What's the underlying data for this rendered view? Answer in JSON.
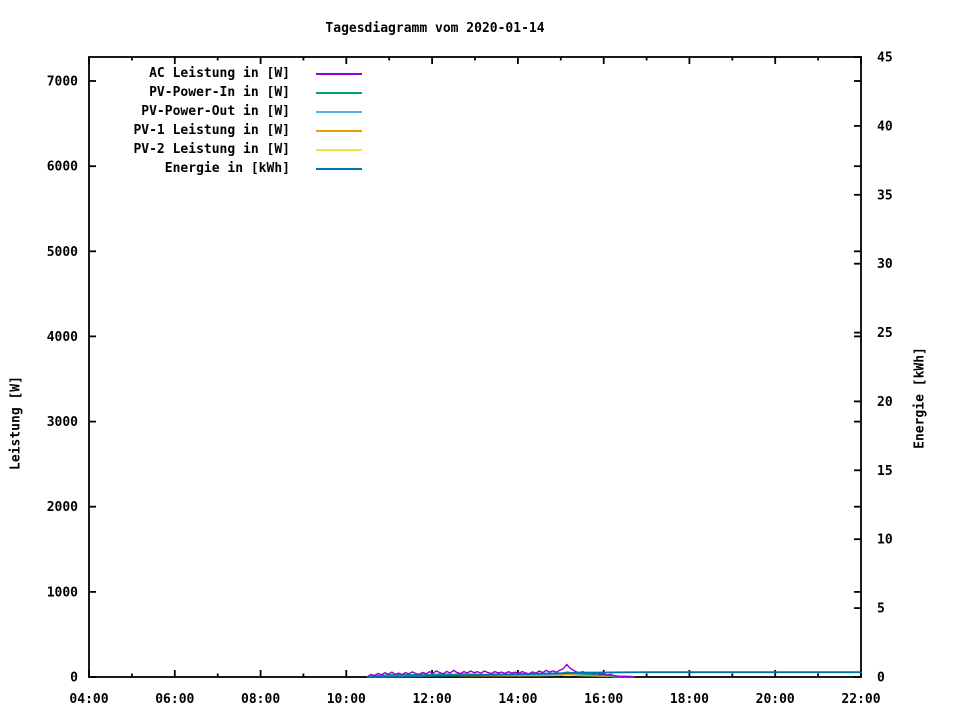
{
  "title": "Tagesdiagramm vom 2020-01-14",
  "chart_data": {
    "type": "line",
    "title": "Tagesdiagramm vom 2020-01-14",
    "grid": false,
    "legend_position": "top-left-inside",
    "background_color": "#ffffff",
    "border_color": "#000000",
    "x_axis": {
      "unit": "time",
      "range_hours": [
        4,
        22
      ],
      "major_tick_hours": [
        4,
        6,
        8,
        10,
        12,
        14,
        16,
        18,
        20,
        22
      ],
      "major_tick_labels": [
        "04:00",
        "06:00",
        "08:00",
        "10:00",
        "12:00",
        "14:00",
        "16:00",
        "18:00",
        "20:00",
        "22:00"
      ],
      "minor_tick_every_hours": 1
    },
    "y1_axis": {
      "label": "Leistung [W]",
      "range": [
        0,
        7282
      ],
      "ticks": [
        0,
        1000,
        2000,
        3000,
        4000,
        5000,
        6000,
        7000
      ],
      "tick_labels": [
        "0",
        "1000",
        "2000",
        "3000",
        "4000",
        "5000",
        "6000",
        "7000"
      ]
    },
    "y2_axis": {
      "label": "Energie [kWh]",
      "range": [
        0,
        45
      ],
      "ticks": [
        0,
        5,
        10,
        15,
        20,
        25,
        30,
        35,
        40,
        45
      ],
      "tick_labels": [
        "0",
        "5",
        "10",
        "15",
        "20",
        "25",
        "30",
        "35",
        "40",
        "45"
      ]
    },
    "series": [
      {
        "name": "AC Leistung in [W]",
        "color": "#9400d3",
        "axis": "y1",
        "points": [
          [
            10.5,
            6
          ],
          [
            10.58,
            30
          ],
          [
            10.66,
            18
          ],
          [
            10.74,
            42
          ],
          [
            10.82,
            25
          ],
          [
            10.9,
            50
          ],
          [
            10.98,
            32
          ],
          [
            11.06,
            58
          ],
          [
            11.14,
            32
          ],
          [
            11.22,
            46
          ],
          [
            11.3,
            28
          ],
          [
            11.38,
            52
          ],
          [
            11.46,
            36
          ],
          [
            11.54,
            60
          ],
          [
            11.62,
            40
          ],
          [
            11.7,
            30
          ],
          [
            11.78,
            54
          ],
          [
            11.86,
            38
          ],
          [
            11.94,
            62
          ],
          [
            12.02,
            44
          ],
          [
            12.1,
            72
          ],
          [
            12.18,
            50
          ],
          [
            12.26,
            38
          ],
          [
            12.34,
            66
          ],
          [
            12.42,
            46
          ],
          [
            12.5,
            78
          ],
          [
            12.58,
            52
          ],
          [
            12.66,
            40
          ],
          [
            12.74,
            64
          ],
          [
            12.82,
            48
          ],
          [
            12.9,
            70
          ],
          [
            12.98,
            50
          ],
          [
            13.06,
            62
          ],
          [
            13.14,
            44
          ],
          [
            13.22,
            70
          ],
          [
            13.3,
            52
          ],
          [
            13.38,
            40
          ],
          [
            13.46,
            64
          ],
          [
            13.54,
            48
          ],
          [
            13.62,
            58
          ],
          [
            13.7,
            42
          ],
          [
            13.78,
            62
          ],
          [
            13.86,
            46
          ],
          [
            13.94,
            56
          ],
          [
            14.02,
            42
          ],
          [
            14.1,
            64
          ],
          [
            14.18,
            48
          ],
          [
            14.26,
            38
          ],
          [
            14.34,
            60
          ],
          [
            14.42,
            46
          ],
          [
            14.5,
            70
          ],
          [
            14.58,
            52
          ],
          [
            14.66,
            78
          ],
          [
            14.74,
            58
          ],
          [
            14.82,
            72
          ],
          [
            14.9,
            56
          ],
          [
            14.98,
            80
          ],
          [
            15.05,
            95
          ],
          [
            15.1,
            125
          ],
          [
            15.14,
            148
          ],
          [
            15.18,
            122
          ],
          [
            15.24,
            95
          ],
          [
            15.3,
            78
          ],
          [
            15.36,
            60
          ],
          [
            15.44,
            52
          ],
          [
            15.52,
            62
          ],
          [
            15.6,
            44
          ],
          [
            15.68,
            54
          ],
          [
            15.76,
            38
          ],
          [
            15.84,
            48
          ],
          [
            15.92,
            32
          ],
          [
            16.0,
            40
          ],
          [
            16.08,
            24
          ],
          [
            16.16,
            32
          ],
          [
            16.24,
            16
          ],
          [
            16.32,
            10
          ],
          [
            16.42,
            6
          ],
          [
            16.5,
            9
          ],
          [
            16.58,
            4
          ],
          [
            16.66,
            6
          ],
          [
            16.7,
            3
          ]
        ]
      },
      {
        "name": "PV-Power-In in [W]",
        "color": "#009e73",
        "axis": "y1",
        "points": [
          [
            10.5,
            4
          ],
          [
            10.75,
            18
          ],
          [
            11.0,
            26
          ],
          [
            11.25,
            30
          ],
          [
            11.5,
            26
          ],
          [
            11.75,
            32
          ],
          [
            12.0,
            28
          ],
          [
            12.25,
            34
          ],
          [
            12.5,
            30
          ],
          [
            12.75,
            36
          ],
          [
            13.0,
            32
          ],
          [
            13.25,
            28
          ],
          [
            13.5,
            34
          ],
          [
            13.75,
            30
          ],
          [
            14.0,
            34
          ],
          [
            14.25,
            30
          ],
          [
            14.5,
            36
          ],
          [
            14.75,
            40
          ],
          [
            15.0,
            44
          ],
          [
            15.15,
            58
          ],
          [
            15.4,
            42
          ],
          [
            15.6,
            34
          ],
          [
            15.8,
            28
          ],
          [
            16.0,
            22
          ],
          [
            16.2,
            14
          ],
          [
            16.4,
            8
          ],
          [
            16.55,
            6
          ],
          [
            16.7,
            3
          ]
        ]
      },
      {
        "name": "PV-Power-Out in [W]",
        "color": "#56b4e9",
        "axis": "y1",
        "points": [
          [
            10.5,
            2
          ],
          [
            10.75,
            14
          ],
          [
            11.0,
            20
          ],
          [
            11.25,
            24
          ],
          [
            11.5,
            21
          ],
          [
            11.75,
            26
          ],
          [
            12.0,
            23
          ],
          [
            12.25,
            28
          ],
          [
            12.5,
            24
          ],
          [
            12.75,
            29
          ],
          [
            13.0,
            26
          ],
          [
            13.25,
            23
          ],
          [
            13.5,
            28
          ],
          [
            13.75,
            24
          ],
          [
            14.0,
            28
          ],
          [
            14.25,
            24
          ],
          [
            14.5,
            30
          ],
          [
            14.75,
            33
          ],
          [
            15.0,
            37
          ],
          [
            15.15,
            50
          ],
          [
            15.4,
            35
          ],
          [
            15.6,
            28
          ],
          [
            15.8,
            22
          ],
          [
            16.0,
            17
          ],
          [
            16.2,
            10
          ],
          [
            16.4,
            6
          ],
          [
            16.55,
            4
          ],
          [
            16.7,
            2
          ]
        ]
      },
      {
        "name": "PV-1 Leistung in [W]",
        "color": "#e69f00",
        "axis": "y1",
        "points": [
          [
            10.5,
            2
          ],
          [
            11.0,
            12
          ],
          [
            11.5,
            14
          ],
          [
            12.0,
            15
          ],
          [
            12.5,
            16
          ],
          [
            13.0,
            17
          ],
          [
            13.5,
            18
          ],
          [
            14.0,
            18
          ],
          [
            14.5,
            19
          ],
          [
            15.0,
            23
          ],
          [
            15.15,
            30
          ],
          [
            15.4,
            22
          ],
          [
            16.0,
            11
          ],
          [
            16.4,
            4
          ],
          [
            16.7,
            2
          ]
        ]
      },
      {
        "name": "PV-2 Leistung in [W]",
        "color": "#f0e442",
        "axis": "y1",
        "points": [
          [
            10.5,
            1
          ],
          [
            11.0,
            10
          ],
          [
            11.5,
            12
          ],
          [
            12.0,
            13
          ],
          [
            12.5,
            14
          ],
          [
            13.0,
            15
          ],
          [
            13.5,
            15
          ],
          [
            14.0,
            15
          ],
          [
            14.5,
            16
          ],
          [
            15.0,
            20
          ],
          [
            15.15,
            26
          ],
          [
            15.4,
            19
          ],
          [
            16.0,
            9
          ],
          [
            16.4,
            3
          ],
          [
            16.7,
            1
          ]
        ]
      },
      {
        "name": "Energie in [kWh]",
        "color": "#0072b2",
        "axis": "y2",
        "points": [
          [
            10.5,
            0.0
          ],
          [
            11.0,
            0.02
          ],
          [
            11.5,
            0.05
          ],
          [
            12.0,
            0.08
          ],
          [
            12.5,
            0.11
          ],
          [
            13.0,
            0.14
          ],
          [
            13.5,
            0.17
          ],
          [
            14.0,
            0.2
          ],
          [
            14.5,
            0.24
          ],
          [
            15.0,
            0.27
          ],
          [
            15.5,
            0.31
          ],
          [
            16.0,
            0.33
          ],
          [
            16.5,
            0.34
          ],
          [
            17.0,
            0.35
          ],
          [
            22.0,
            0.35
          ]
        ]
      }
    ]
  }
}
